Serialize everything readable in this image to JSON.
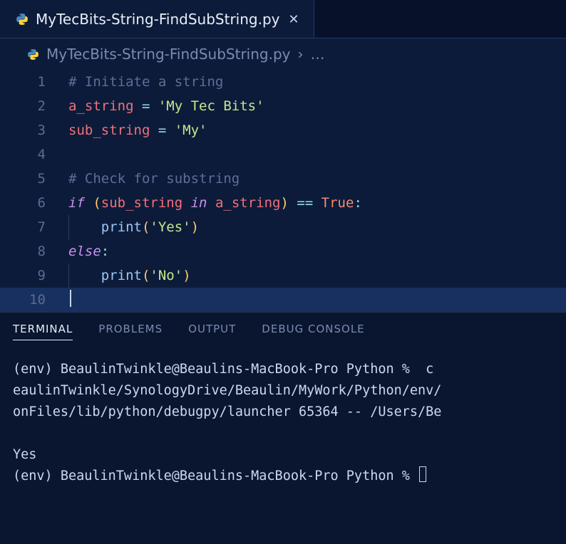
{
  "tab": {
    "filename": "MyTecBits-String-FindSubString.py"
  },
  "breadcrumb": {
    "filename": "MyTecBits-String-FindSubString.py",
    "separator": "›",
    "ellipsis": "…"
  },
  "editor": {
    "lines": [
      {
        "num": "1"
      },
      {
        "num": "2"
      },
      {
        "num": "3"
      },
      {
        "num": "4"
      },
      {
        "num": "5"
      },
      {
        "num": "6"
      },
      {
        "num": "7"
      },
      {
        "num": "8"
      },
      {
        "num": "9"
      },
      {
        "num": "10"
      }
    ],
    "l1_comment": "# Initiate a string",
    "l2": {
      "var": "a_string",
      "eq": " = ",
      "str": "'My Tec Bits'"
    },
    "l3": {
      "var": "sub_string",
      "eq": " = ",
      "str": "'My'"
    },
    "l5_comment": "# Check for substring",
    "l6": {
      "if": "if ",
      "lp": "(",
      "v1": "sub_string",
      "in": " in ",
      "v2": "a_string",
      "rp": ")",
      "eqeq": " == ",
      "true": "True",
      "colon": ":"
    },
    "l7": {
      "indent": "    ",
      "func": "print",
      "lp": "(",
      "str": "'Yes'",
      "rp": ")"
    },
    "l8": {
      "else": "else",
      "colon": ":"
    },
    "l9": {
      "indent": "    ",
      "func": "print",
      "lp": "(",
      "str": "'No'",
      "rp": ")"
    }
  },
  "panel": {
    "tabs": {
      "terminal": "TERMINAL",
      "problems": "PROBLEMS",
      "output": "OUTPUT",
      "debug": "DEBUG CONSOLE"
    },
    "terminal": {
      "line1": "(env) BeaulinTwinkle@Beaulins-MacBook-Pro Python %  c",
      "line2": "eaulinTwinkle/SynologyDrive/Beaulin/MyWork/Python/env/",
      "line3": "onFiles/lib/python/debugpy/launcher 65364 -- /Users/Be",
      "blank": "",
      "output": "Yes",
      "prompt": "(env) BeaulinTwinkle@Beaulins-MacBook-Pro Python % "
    }
  }
}
